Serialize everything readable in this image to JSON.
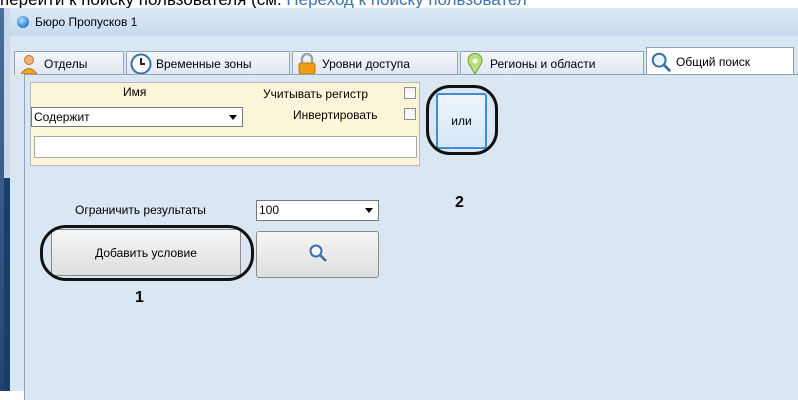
{
  "top_text": {
    "plain": "перейти к поиску пользователя (см. ",
    "link": "Переход к поиску пользовател"
  },
  "window": {
    "title": "Бюро Пропусков 1"
  },
  "tabs": [
    {
      "label": "Отделы",
      "icon": "person-icon"
    },
    {
      "label": "Временные зоны",
      "icon": "clock-icon"
    },
    {
      "label": "Уровни доступа",
      "icon": "lock-icon"
    },
    {
      "label": "Регионы и области",
      "icon": "map-pin-icon"
    },
    {
      "label": "Общий поиск",
      "icon": "search-icon",
      "active": true
    }
  ],
  "condition": {
    "field_label": "Имя",
    "operator_value": "Содержит",
    "case_label": "Учитывать регистр",
    "case_checked": false,
    "invert_label": "Инвертировать",
    "invert_checked": false,
    "value": ""
  },
  "or_button": "или",
  "limit": {
    "label": "Ограничить результаты",
    "value": "100"
  },
  "add_condition_button": "Добавить условие",
  "callouts": {
    "one": "1",
    "two": "2"
  }
}
